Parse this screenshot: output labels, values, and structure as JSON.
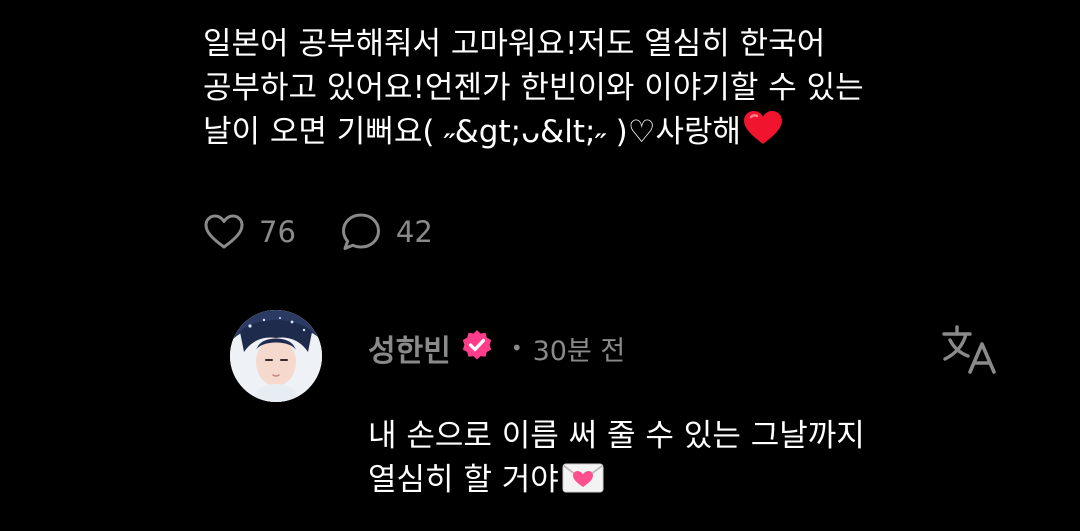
{
  "comment": {
    "text_lines": [
      "일본어 공부해줘서 고마워요!저도 열심히 한국어",
      "공부하고 있어요!언젠가 한빈이와 이야기할 수 있는",
      "날이 오면 기뻐요( ˶&gt;ᴗ&lt;˶ )♡사랑해"
    ],
    "emoji": "red-heart-emoji",
    "likes": "76",
    "replies": "42"
  },
  "reply": {
    "author": "성한빈",
    "separator": "•",
    "timestamp": "30분 전",
    "text_lines": [
      "내 손으로 이름 써 줄 수 있는 그날까지",
      "열심히 할 거야"
    ],
    "emoji": "love-letter-emoji"
  },
  "icons": {
    "like": "heart-outline-icon",
    "reply": "speech-bubble-icon",
    "verified": "verified-badge-icon",
    "translate": "translate-icon"
  },
  "colors": {
    "background": "#000000",
    "text": "#ffffff",
    "muted": "#8a8a8a",
    "verified_badge": "#ff3d8b"
  }
}
